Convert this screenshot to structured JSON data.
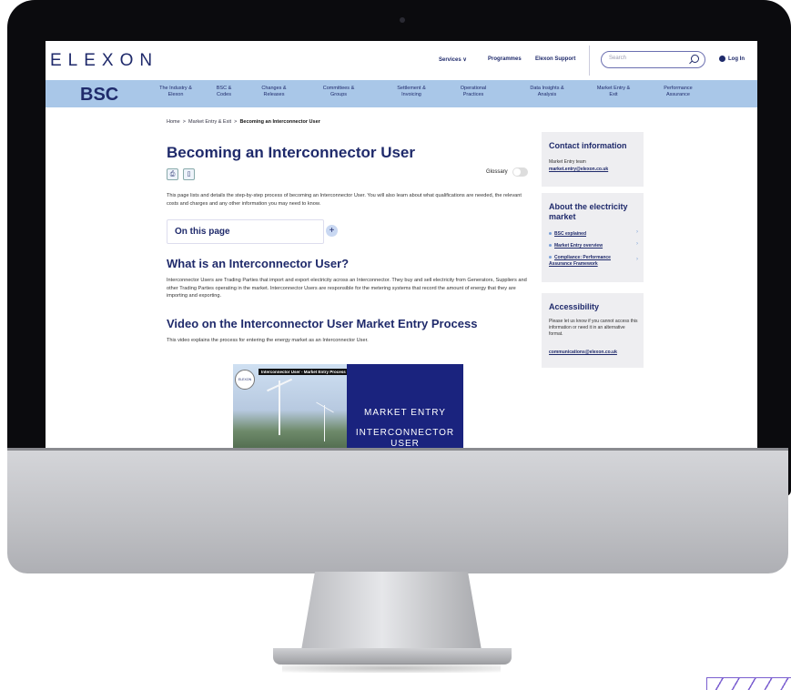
{
  "header": {
    "logo": "ELEXON",
    "nav": [
      "Services ∨",
      "Programmes",
      "Elexon Support"
    ],
    "search_placeholder": "Search",
    "login": "Log In"
  },
  "bsc_bar": {
    "title": "BSC",
    "items": [
      [
        "The Industry &",
        "Elexon"
      ],
      [
        "BSC &",
        "Codes"
      ],
      [
        "Changes &",
        "Releases"
      ],
      [
        "Committees &",
        "Groups"
      ],
      [
        "Settlement &",
        "Invoicing"
      ],
      [
        "Operational",
        "Practices"
      ],
      [
        "Data Insights &",
        "Analysis"
      ],
      [
        "Market Entry &",
        "Exit"
      ],
      [
        "Performance",
        "Assurance"
      ]
    ]
  },
  "breadcrumb": {
    "home": "Home",
    "sep": ">",
    "parent": "Market Entry & Exit",
    "current": "Becoming an Interconnector User"
  },
  "page": {
    "title": "Becoming an Interconnector User",
    "glossary": "Glossary",
    "intro": "This page lists and details the step-by-step process of becoming an Interconnector User. You will also learn about what qualifications are needed, the relevant costs and charges and any other information you may need to know.",
    "on_this_page": "On this page",
    "h2_what": "What is an Interconnector User?",
    "what_text": "Interconnector Users are Trading Parties that import and export electricity across an Interconnector. They buy and sell electricity from Generators, Suppliers and other Trading Parties operating in the market. Interconnector Users are responsible for the metering systems that record the amount of energy that they are importing and exporting.",
    "h2_video": "Video on the Interconnector User Market Entry Process",
    "video_text": "This video explains the process for entering the energy market as an Interconnector User.",
    "video": {
      "title": "Interconnector User - Market Entry Process",
      "logo": "ELEXON",
      "line1": "MARKET ENTRY",
      "line2": "INTERCONNECTOR",
      "line3": "USER"
    }
  },
  "sidebar": {
    "contact": {
      "heading": "Contact information",
      "team": "Market Entry team",
      "email": "market.entry@elexon.co.uk"
    },
    "about": {
      "heading": "About the electricity market",
      "links": [
        "BSC explained",
        "Market Entry overview",
        "Compliance: Performance Assurance Framework"
      ]
    },
    "accessibility": {
      "heading": "Accessibility",
      "text": "Please let us know if you cannot access this information or need it in an alternative format.",
      "email": "communications@elexon.co.uk"
    }
  },
  "colors": {
    "navy": "#1f2a6b",
    "bsc_bar": "#a9c7e8",
    "video_blue": "#1a237e"
  }
}
